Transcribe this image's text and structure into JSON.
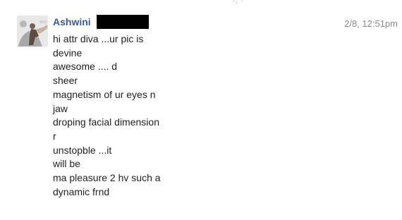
{
  "top_fragment": "·, ·",
  "message": {
    "author": "Ashwini",
    "timestamp": "2/8, 12:51pm",
    "lines": [
      "hi attr diva ...ur pic is",
      "devine",
      "awesome .... d",
      "sheer",
      "magnetism of ur eyes n",
      "jaw",
      "droping facial dimension",
      "r",
      "unstopble ...it",
      "will be",
      "ma pleasure 2 hv such a",
      "dynamic frnd"
    ]
  },
  "colors": {
    "author_name": "#3b5998",
    "timestamp": "#8a8a8a",
    "body_text": "#222222",
    "redaction": "#000000"
  }
}
